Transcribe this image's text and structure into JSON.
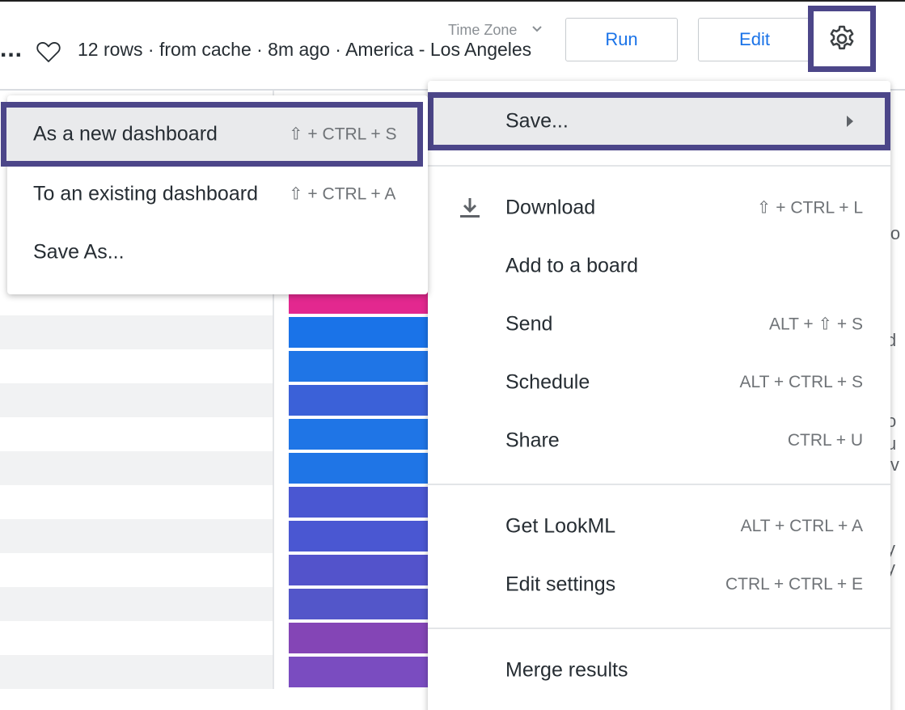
{
  "header": {
    "ellipsis": "...",
    "status": "12 rows · from cache · 8m ago · America - Los Angeles",
    "timezone_label": "Time Zone",
    "run_label": "Run",
    "edit_label": "Edit"
  },
  "colors": {
    "accent": "#1a73e8",
    "highlight_border": "#4c4689",
    "bar_colors": [
      "#e3288f",
      "#1a73e8",
      "#1f75e6",
      "#3b61d8",
      "#1f75e6",
      "#1f75e6",
      "#4a57d2",
      "#4a57d2",
      "#5353cb",
      "#5356c9",
      "#8445b6",
      "#7a4cc0"
    ]
  },
  "edge_snippets": [
    "io",
    "d",
    "o",
    "u",
    "iv",
    "y",
    "y"
  ],
  "menu": {
    "save": {
      "label": "Save..."
    },
    "items": [
      {
        "label": "Download",
        "shortcut": "⇧ + CTRL + L",
        "icon": "download-icon"
      },
      {
        "label": "Add to a board",
        "shortcut": ""
      },
      {
        "label": "Send",
        "shortcut": "ALT + ⇧ + S"
      },
      {
        "label": "Schedule",
        "shortcut": "ALT + CTRL + S"
      },
      {
        "label": "Share",
        "shortcut": "CTRL + U"
      },
      {
        "label": "Get LookML",
        "shortcut": "ALT + CTRL + A"
      },
      {
        "label": "Edit settings",
        "shortcut": "CTRL + CTRL + E"
      },
      {
        "label": "Merge results",
        "shortcut": ""
      }
    ]
  },
  "submenu": {
    "items": [
      {
        "label": "As a new dashboard",
        "shortcut": "⇧ + CTRL + S"
      },
      {
        "label": "To an existing dashboard",
        "shortcut": "⇧ + CTRL + A"
      },
      {
        "label": "Save As...",
        "shortcut": ""
      }
    ]
  }
}
